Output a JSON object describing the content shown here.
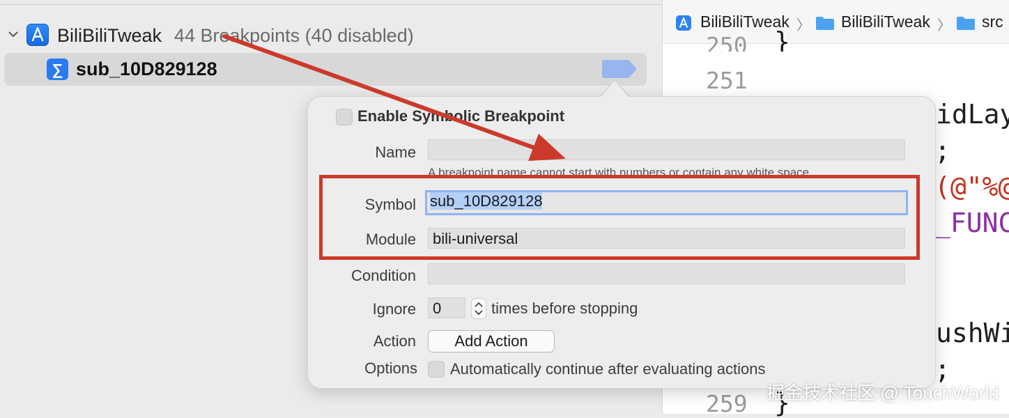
{
  "navigator": {
    "project": {
      "name": "BiliBiliTweak",
      "count_text": "44 Breakpoints (40 disabled)"
    },
    "breakpoint": {
      "name": "sub_10D829128"
    }
  },
  "editor": {
    "jumpbar": [
      "BiliBiliTweak",
      "BiliBiliTweak",
      "src"
    ],
    "line_numbers": [
      "250",
      "251",
      "259"
    ],
    "code_fragments": [
      "}",
      "idLay",
      ";",
      "(@\"%@",
      "_FUNC",
      "ushWi",
      ";",
      "}"
    ]
  },
  "popover": {
    "enable_label": "Enable Symbolic Breakpoint",
    "name": {
      "label": "Name",
      "value": "",
      "hint": "A breakpoint name cannot start with numbers or contain any white space"
    },
    "symbol": {
      "label": "Symbol",
      "value": "sub_10D829128"
    },
    "module": {
      "label": "Module",
      "value": "bili-universal"
    },
    "condition": {
      "label": "Condition",
      "value": ""
    },
    "ignore": {
      "label": "Ignore",
      "value": "0",
      "suffix": "times before stopping"
    },
    "action": {
      "label": "Action",
      "button": "Add Action"
    },
    "options": {
      "label": "Options",
      "checkbox_text": "Automatically continue after evaluating actions"
    }
  },
  "watermark": "掘金技术社区 @ TouchWorld",
  "colors": {
    "annotation_red": "#cc3a2b",
    "selection_blue": "#b4cff8",
    "accent_blue": "#2a7bf0"
  }
}
